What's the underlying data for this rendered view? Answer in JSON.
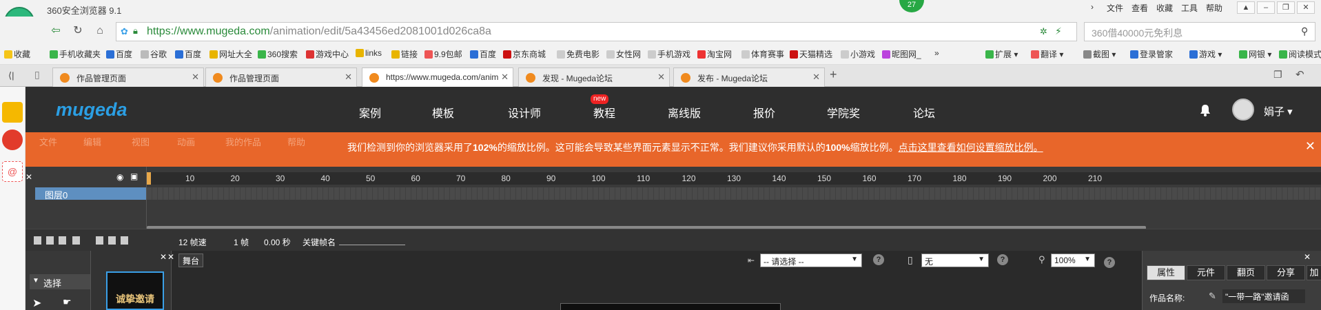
{
  "browser": {
    "title": "360安全浏览器 9.1",
    "badge": "27",
    "menu": [
      "文件",
      "查看",
      "收藏",
      "工具",
      "帮助"
    ],
    "url_domain": "https://www.mugeda.com",
    "url_path": "/animation/edit/5a43456ed2081001d026ca8a",
    "search_placeholder": "360借40000元免利息"
  },
  "bookmarks": {
    "items": [
      "收藏",
      "手机收藏夹",
      "百度",
      "谷歌",
      "百度",
      "网址大全",
      "360搜索",
      "游戏中心",
      "links",
      "链接",
      "9.9包邮",
      "百度",
      "京东商城",
      "免费电影",
      "女性网",
      "手机游戏",
      "淘宝网",
      "体育赛事",
      "天猫精选",
      "小游戏",
      "昵图网_"
    ],
    "more": "»",
    "right": [
      "扩展",
      "翻译",
      "截图",
      "登录管家",
      "游戏",
      "网银",
      "阅读模式"
    ]
  },
  "tabs": [
    {
      "label": "作品管理页面"
    },
    {
      "label": "作品管理页面"
    },
    {
      "label": "https://www.mugeda.com/anim"
    },
    {
      "label": "发现 - Mugeda论坛"
    },
    {
      "label": "发布 - Mugeda论坛"
    }
  ],
  "site": {
    "logo": "mugeda",
    "nav": [
      "案例",
      "模板",
      "设计师",
      "教程",
      "离线版",
      "报价",
      "学院奖",
      "论坛"
    ],
    "new_badge": "new",
    "user": "娟子 ▾"
  },
  "editor_menu": [
    "文件",
    "编辑",
    "视图",
    "动画",
    "我的作品",
    "帮助"
  ],
  "warning": {
    "pre": "我们检测到你的浏览器采用了",
    "current_zoom": "102%",
    "mid": "的缩放比例。这可能会导致某些界面元素显示不正常。我们建议你采用默认的",
    "default_zoom": "100%",
    "post": "缩放比例。",
    "link": "点击这里查看如何设置缩放比例。",
    "close": "✕"
  },
  "timeline": {
    "ruler_ticks": [
      "10",
      "20",
      "30",
      "40",
      "50",
      "60",
      "70",
      "80",
      "90",
      "100",
      "110",
      "120",
      "130",
      "140",
      "150",
      "160",
      "170",
      "180",
      "190",
      "200",
      "210"
    ],
    "layer_name": "图层0",
    "fps": "12 帧速",
    "frame": "1 帧",
    "seconds": "0.00 秒",
    "keyframe_label": "关键帧名"
  },
  "tools": {
    "select_label": "选择"
  },
  "thumb": {
    "text": "诚挚邀请"
  },
  "stage": {
    "tab_label": "舞台",
    "select1": "-- 请选择 --",
    "select2": "无",
    "zoom": "100%",
    "help": "?"
  },
  "props": {
    "tabs": [
      "属性",
      "元件",
      "翻页",
      "分享",
      "加载"
    ],
    "name_label": "作品名称:",
    "name_value": "\"一带一路\"邀请函"
  },
  "colors": {
    "accent_orange": "#e8662a",
    "brand_blue": "#2b9fe4",
    "layer_blue": "#5e8fc0"
  }
}
